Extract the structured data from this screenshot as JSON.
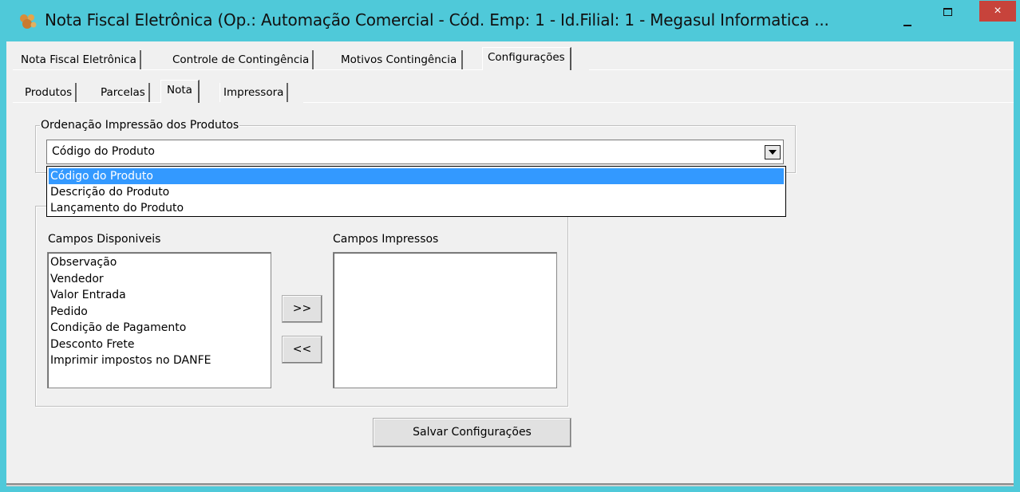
{
  "window": {
    "title": "Nota Fiscal Eletrônica (Op.: Automação Comercial - Cód. Emp: 1 - Id.Filial: 1 - Megasul Informatica ...",
    "close_label": "×"
  },
  "main_tabs": [
    {
      "label": "Nota Fiscal Eletrônica"
    },
    {
      "label": "Controle de Contingência"
    },
    {
      "label": "Motivos Contingência"
    },
    {
      "label": "Configurações"
    }
  ],
  "sub_tabs": [
    {
      "label": "Produtos"
    },
    {
      "label": "Parcelas"
    },
    {
      "label": "Nota"
    },
    {
      "label": "Impressora"
    }
  ],
  "ordering": {
    "group_label": "Ordenação Impressão dos Produtos",
    "selected": "Código do Produto",
    "options": [
      "Código do Produto",
      "Descrição do Produto",
      "Lançamento do Produto"
    ]
  },
  "fields": {
    "available_label": "Campos Disponiveis",
    "printed_label": "Campos Impressos",
    "available": [
      "Observação",
      "Vendedor",
      "Valor Entrada",
      "Pedido",
      "Condição de Pagamento",
      "Desconto Frete",
      "Imprimir impostos no DANFE"
    ],
    "printed": [],
    "add_button": ">>",
    "remove_button": "<<"
  },
  "save_button": "Salvar Configurações",
  "colors": {
    "titlebar": "#4fc9d9",
    "close": "#c7433b",
    "selection": "#3399ff"
  }
}
